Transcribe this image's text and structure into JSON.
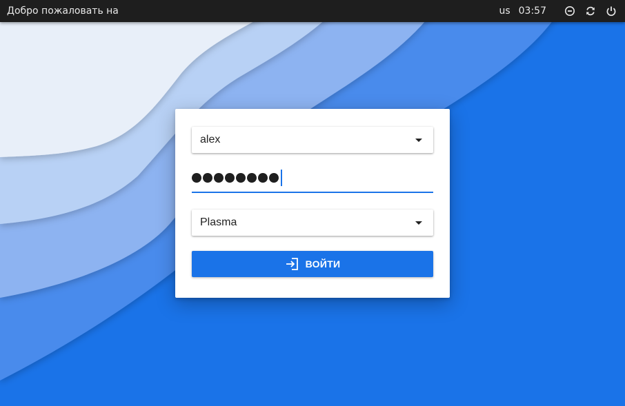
{
  "topbar": {
    "welcome_text": "Добро пожаловать на",
    "keyboard_layout": "us",
    "clock": "03:57",
    "icons": [
      "suspend-icon",
      "restart-icon",
      "power-icon"
    ]
  },
  "login": {
    "user": "alex",
    "password_length": 8,
    "session": "Plasma",
    "login_button_label": "ВОЙТИ",
    "login_button_icon": "login-icon"
  },
  "colors": {
    "accent": "#1a73e8",
    "topbar_bg": "#1e1e1e",
    "wave_lightest": "#e8eff9",
    "wave_light": "#b8d1f5",
    "wave_mid": "#8db3f1",
    "wave_deep": "#4a8bec"
  }
}
